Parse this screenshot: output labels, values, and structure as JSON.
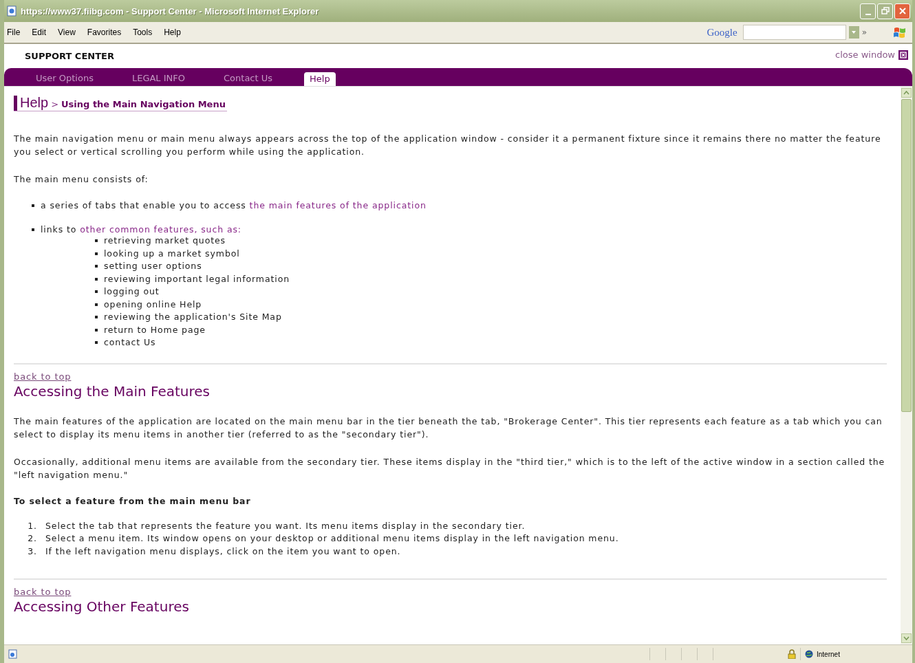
{
  "window": {
    "title": "https://www37.fiibg.com - Support Center - Microsoft Internet Explorer"
  },
  "menu_bar": {
    "items": [
      "File",
      "Edit",
      "View",
      "Favorites",
      "Tools",
      "Help"
    ],
    "search_brand": "Google",
    "chevron": "»"
  },
  "header": {
    "title": "SUPPORT CENTER",
    "close_link": "close window"
  },
  "tabs": [
    {
      "label": "User Options",
      "selected": false
    },
    {
      "label": "LEGAL INFO",
      "selected": false
    },
    {
      "label": "Contact Us",
      "selected": false
    },
    {
      "label": "Help",
      "selected": true
    }
  ],
  "breadcrumb": {
    "section": "Help",
    "separator": ">",
    "page": "Using the Main Navigation Menu"
  },
  "content": [
    {
      "kind": "paragraph",
      "text": "The main navigation menu or main menu always appears across the top of the application window - consider it a permanent fixture since it remains there no matter the feature you select or vertical scrolling you perform while using the application."
    },
    {
      "kind": "paragraph",
      "text": "The main menu consists of:"
    },
    {
      "kind": "bullets",
      "items": [
        {
          "text": "a series of tabs that enable you to access ",
          "link": "the main features of the application"
        },
        {
          "text": "links to ",
          "link": "other common features, such as:",
          "children": [
            "retrieving market quotes",
            "looking up a market symbol",
            "setting user options",
            "reviewing important legal information",
            "logging out",
            "opening online Help",
            "reviewing the application's Site Map",
            "return to Home page",
            "contact Us"
          ]
        }
      ]
    },
    {
      "kind": "rule"
    },
    {
      "kind": "back_link",
      "text": "back to top"
    },
    {
      "kind": "heading",
      "text": "Accessing the Main Features"
    },
    {
      "kind": "paragraph",
      "text": "The main features of the application are located on the main menu bar in the tier beneath the tab, \"Brokerage Center\". This tier represents each feature as a tab which you can select to display its menu items in another tier (referred to as the \"secondary tier\")."
    },
    {
      "kind": "paragraph",
      "text": "Occasionally, additional menu items are available from the secondary tier. These items display in the \"third tier,\" which is to the left of the active window in a section called the \"left navigation menu.\""
    },
    {
      "kind": "subheading",
      "text": "To select a feature from the main menu bar"
    },
    {
      "kind": "steps",
      "items": [
        {
          "number": "1.",
          "text": "Select the tab that represents the feature you want. Its menu items display in the secondary tier."
        },
        {
          "number": "2.",
          "text": "Select a menu item. Its window opens on your desktop or additional menu items display in the left navigation menu."
        },
        {
          "number": "3.",
          "text": "If the left navigation menu displays, click on the item you want to open."
        }
      ]
    },
    {
      "kind": "rule"
    },
    {
      "kind": "back_link",
      "text": "back to top"
    },
    {
      "kind": "heading",
      "text": "Accessing Other Features"
    }
  ],
  "status_bar": {
    "zone": "Internet"
  }
}
